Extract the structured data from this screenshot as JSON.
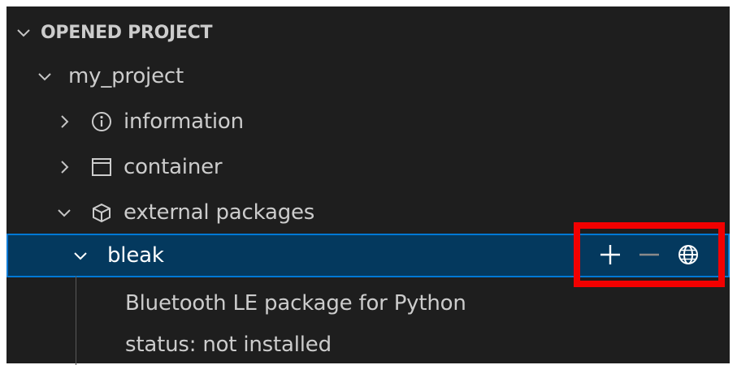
{
  "section": {
    "title": "OPENED PROJECT",
    "chevron_icon": "chevron-down-icon"
  },
  "tree": {
    "project": {
      "label": "my_project"
    },
    "information": {
      "label": "information",
      "icon": "info-icon"
    },
    "container": {
      "label": "container",
      "icon": "window-icon"
    },
    "external_packages": {
      "label": "external packages",
      "icon": "package-icon"
    },
    "package": {
      "label": "bleak",
      "description": "Bluetooth LE package for Python",
      "status": "status: not installed",
      "actions": [
        "add-icon",
        "remove-icon",
        "globe-icon"
      ]
    }
  },
  "colors": {
    "background": "#1e1e1e",
    "selection": "#04395e",
    "selection_border": "#0078d4",
    "highlight_box": "#f20000",
    "text": "#cccccc"
  }
}
